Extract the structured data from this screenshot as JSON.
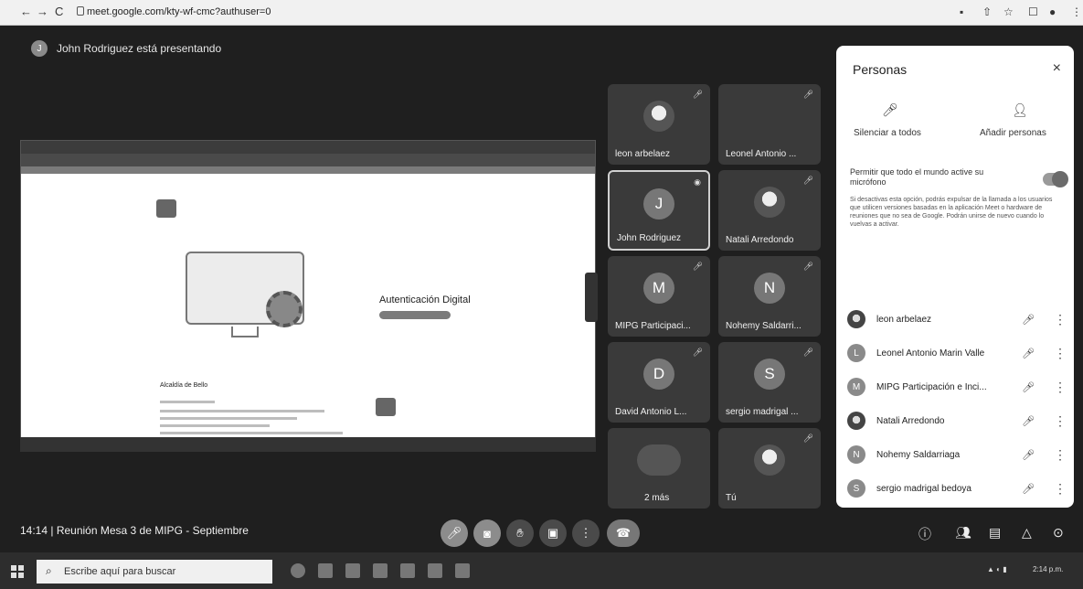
{
  "browser": {
    "url": "meet.google.com/kty-wf-cmc?authuser=0",
    "back_glyph": "←",
    "forward_glyph": "→",
    "reload_glyph": "C",
    "icons": [
      "camera-icon",
      "share-icon",
      "star-icon",
      "tab-icon",
      "profile-icon",
      "menu-icon"
    ]
  },
  "meet": {
    "presenter_initial": "J",
    "presenter_text": "John Rodriguez está presentando",
    "meeting_time": "14:14",
    "meeting_name": "Reunión Mesa 3 de MIPG - Septiembre"
  },
  "shared_screen": {
    "title": "Autenticación Digital",
    "section": "Alcaldía de Bello"
  },
  "tiles": [
    {
      "name": "leon arbelaez",
      "photo": true,
      "initial": ""
    },
    {
      "name": "Leonel Antonio ...",
      "photo": false,
      "initial": ""
    },
    {
      "name": "John Rodriguez",
      "photo": false,
      "initial": "J"
    },
    {
      "name": "Natali Arredondo",
      "photo": true,
      "initial": ""
    },
    {
      "name": "MIPG Participaci...",
      "photo": false,
      "initial": "M"
    },
    {
      "name": "Nohemy Saldarri...",
      "photo": false,
      "initial": "N"
    },
    {
      "name": "David Antonio L...",
      "photo": false,
      "initial": "D"
    },
    {
      "name": "sergio madrigal ...",
      "photo": false,
      "initial": "S"
    },
    {
      "name": "2 más",
      "photo": false,
      "initial": ""
    },
    {
      "name": "Tú",
      "photo": true,
      "initial": ""
    }
  ],
  "panel": {
    "title": "Personas",
    "close": "×",
    "mute_all": "Silenciar a todos",
    "add_people": "Añadir personas",
    "allow_mic_label": "Permitir que todo el mundo active su micrófono",
    "allow_mic_desc": "Si desactivas esta opción, podrás expulsar de la llamada a los usuarios que utilicen versiones basadas en la aplicación Meet o hardware de reuniones que no sea de Google. Podrán unirse de nuevo cuando lo vuelvas a activar.",
    "people": [
      {
        "name": "leon arbelaez",
        "initial": "",
        "photo": true
      },
      {
        "name": "Leonel Antonio Marin Valle",
        "initial": "L",
        "photo": false
      },
      {
        "name": "MIPG Participación e Inci...",
        "initial": "M",
        "photo": false
      },
      {
        "name": "Natali Arredondo",
        "initial": "",
        "photo": true
      },
      {
        "name": "Nohemy Saldarriaga",
        "initial": "N",
        "photo": false
      },
      {
        "name": "sergio madrigal bedoya",
        "initial": "S",
        "photo": false
      }
    ]
  },
  "taskbar": {
    "search_placeholder": "Escribe aquí para buscar",
    "clock": "2:14 p.m."
  }
}
